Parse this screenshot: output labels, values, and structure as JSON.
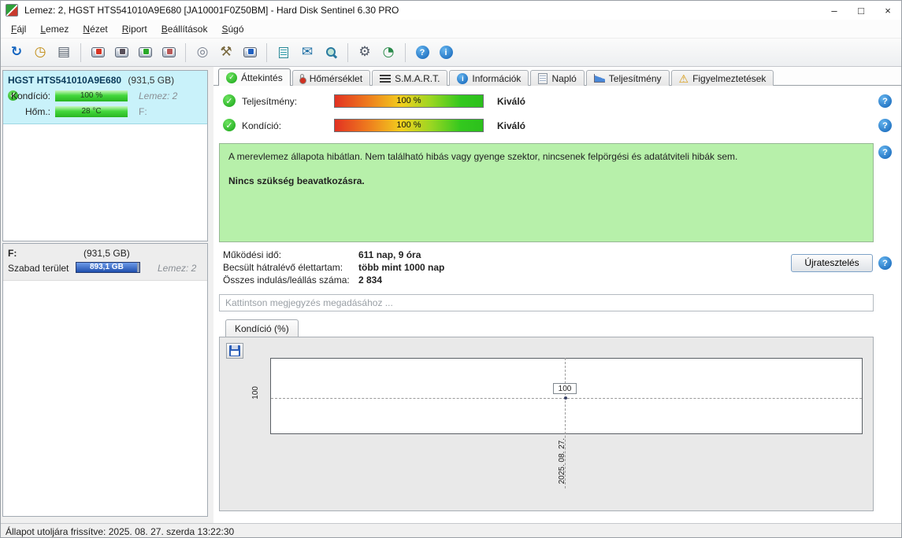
{
  "window": {
    "title": "Lemez: 2, HGST HTS541010A9E680 [JA10001F0Z50BM]  -  Hard Disk Sentinel 6.30 PRO"
  },
  "menu": {
    "items": [
      "Fájl",
      "Lemez",
      "Nézet",
      "Riport",
      "Beállítások",
      "Súgó"
    ]
  },
  "tabs": {
    "active": "Áttekintés",
    "items": [
      {
        "label": "Áttekintés"
      },
      {
        "label": "Hőmérséklet"
      },
      {
        "label": "S.M.A.R.T."
      },
      {
        "label": "Információk"
      },
      {
        "label": "Napló"
      },
      {
        "label": "Teljesítmény"
      },
      {
        "label": "Figyelmeztetések"
      }
    ]
  },
  "sidebar": {
    "disk": {
      "name": "HGST HTS541010A9E680",
      "size": "(931,5 GB)",
      "condition_label": "Kondíció:",
      "condition_value": "100 %",
      "condition_disk": "Lemez: 2",
      "temp_label": "Hőm.:",
      "temp_value": "28 °C",
      "temp_drive": "F:"
    },
    "partition": {
      "name": "F:",
      "size": "(931,5 GB)",
      "free_label": "Szabad terület",
      "free_value": "893,1 GB",
      "free_percent": 96,
      "disk": "Lemez: 2"
    }
  },
  "overview": {
    "performance": {
      "label": "Teljesítmény:",
      "value": "100 %",
      "rating": "Kiváló"
    },
    "condition": {
      "label": "Kondíció:",
      "value": "100 %",
      "rating": "Kiváló"
    },
    "message": "A merevlemez állapota hibátlan. Nem található hibás vagy gyenge szektor, nincsenek felpörgési és adatátviteli hibák sem.",
    "message_bold": "Nincs szükség beavatkozásra.",
    "stats": [
      {
        "label": "Működési idő:",
        "value": "611 nap, 9 óra"
      },
      {
        "label": "Becsült hátralévő élettartam:",
        "value": "több mint 1000 nap"
      },
      {
        "label": "Összes indulás/leállás száma:",
        "value": "2 834"
      }
    ],
    "retest_button": "Újratesztelés",
    "comment_placeholder": "Kattintson megjegyzés megadásához ..."
  },
  "chart": {
    "tab_label": "Kondíció  (%)",
    "axis_value": "100",
    "point_value": "100",
    "date_label": "2025. 08. 27."
  },
  "chart_data": {
    "type": "line",
    "title": "Kondíció (%)",
    "x": [
      "2025. 08. 27."
    ],
    "series": [
      {
        "name": "Kondíció",
        "values": [
          100
        ]
      }
    ],
    "ylabel": "%",
    "ylim": [
      0,
      100
    ],
    "grid": "dashed reference line at 100"
  },
  "statusbar": {
    "text": "Állapot utoljára frissítve: 2025. 08. 27. szerda 13:22:30"
  },
  "icons": {
    "refresh": "↻",
    "clock": "◷",
    "surface": "▤",
    "cdrom": "◎",
    "tools": "⚒",
    "email": "✉",
    "settings": "⚙",
    "gauge": "◔",
    "question": "?",
    "info": "i",
    "check": "✓",
    "warning": "⚠",
    "minimize": "–",
    "maximize": "□",
    "close": "×"
  },
  "colors": {
    "selected_disk_bg": "#c9f2fa",
    "health_bar_green": "#2cc020",
    "free_space_blue": "#1f4fae",
    "message_box_green": "#b7f0aa",
    "accent_blue": "#1061b6"
  }
}
